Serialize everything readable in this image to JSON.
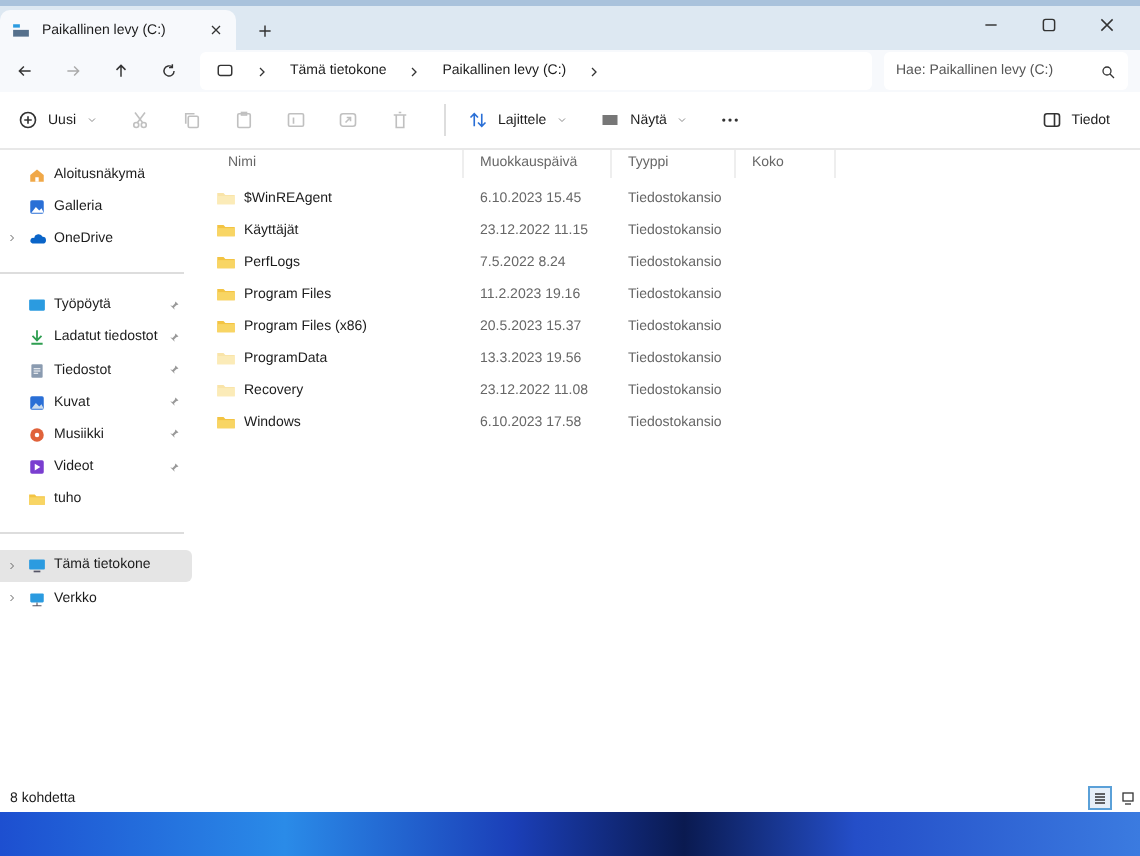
{
  "window": {
    "tabs": [
      {
        "label": "Paikallinen levy (C:)",
        "selected": true
      }
    ]
  },
  "address": {
    "breadcrumbs": [
      "Tämä tietokone",
      "Paikallinen levy (C:)"
    ],
    "search": {
      "placeholder": "Hae: Paikallinen levy (C:)"
    }
  },
  "toolbar": {
    "items": [
      {
        "kind": "new",
        "label": "Uusi",
        "disabled": false
      },
      {
        "kind": "cut",
        "disabled": true
      },
      {
        "kind": "copy",
        "disabled": true
      },
      {
        "kind": "paste",
        "disabled": true
      },
      {
        "kind": "rename",
        "disabled": true
      },
      {
        "kind": "share",
        "disabled": true
      },
      {
        "kind": "delete",
        "disabled": true
      },
      {
        "kind": "sort",
        "label": "Lajittele",
        "disabled": false
      },
      {
        "kind": "view",
        "label": "Näytä",
        "disabled": false
      },
      {
        "kind": "more",
        "disabled": false
      }
    ],
    "details": {
      "label": "Tiedot"
    }
  },
  "sidebar": {
    "groups": [
      [
        {
          "kind": "home",
          "label": "Aloitusnäkymä",
          "expandable": false,
          "pinned": false,
          "selected": false
        },
        {
          "kind": "gallery",
          "label": "Galleria",
          "expandable": false,
          "pinned": false,
          "selected": false
        },
        {
          "kind": "cloud",
          "label": "OneDrive",
          "expandable": true,
          "pinned": false,
          "selected": false
        }
      ],
      [
        {
          "kind": "desktop",
          "label": "Työpöytä",
          "expandable": false,
          "pinned": true,
          "selected": false
        },
        {
          "kind": "download",
          "label": "Ladatut tiedostot",
          "expandable": false,
          "pinned": true,
          "selected": false
        },
        {
          "kind": "documents",
          "label": "Tiedostot",
          "expandable": false,
          "pinned": true,
          "selected": false
        },
        {
          "kind": "pictures",
          "label": "Kuvat",
          "expandable": false,
          "pinned": true,
          "selected": false
        },
        {
          "kind": "music",
          "label": "Musiikki",
          "expandable": false,
          "pinned": true,
          "selected": false
        },
        {
          "kind": "videos",
          "label": "Videot",
          "expandable": false,
          "pinned": true,
          "selected": false
        },
        {
          "kind": "folder",
          "label": "tuho",
          "expandable": false,
          "pinned": false,
          "selected": false
        }
      ],
      [
        {
          "kind": "computer",
          "label": "Tämä tietokone",
          "expandable": true,
          "pinned": false,
          "selected": true
        },
        {
          "kind": "network",
          "label": "Verkko",
          "expandable": true,
          "pinned": false,
          "selected": false
        }
      ]
    ]
  },
  "table": {
    "columns": [
      "Nimi",
      "Muokkauspäivä",
      "Tyyppi",
      "Koko"
    ],
    "rows": [
      {
        "name": "$WinREAgent",
        "modified": "6.10.2023 15.45",
        "type": "Tiedostokansio",
        "hidden": true
      },
      {
        "name": "Käyttäjät",
        "modified": "23.12.2022 11.15",
        "type": "Tiedostokansio",
        "hidden": false
      },
      {
        "name": "PerfLogs",
        "modified": "7.5.2022 8.24",
        "type": "Tiedostokansio",
        "hidden": false
      },
      {
        "name": "Program Files",
        "modified": "11.2.2023 19.16",
        "type": "Tiedostokansio",
        "hidden": false
      },
      {
        "name": "Program Files (x86)",
        "modified": "20.5.2023 15.37",
        "type": "Tiedostokansio",
        "hidden": false
      },
      {
        "name": "ProgramData",
        "modified": "13.3.2023 19.56",
        "type": "Tiedostokansio",
        "hidden": true
      },
      {
        "name": "Recovery",
        "modified": "23.12.2022 11.08",
        "type": "Tiedostokansio",
        "hidden": true
      },
      {
        "name": "Windows",
        "modified": "6.10.2023 17.58",
        "type": "Tiedostokansio",
        "hidden": false
      }
    ]
  },
  "status_bar": {
    "count": "8 kohdetta",
    "views": [
      {
        "kind": "details",
        "selected": true
      },
      {
        "kind": "tiles",
        "selected": false
      }
    ]
  }
}
